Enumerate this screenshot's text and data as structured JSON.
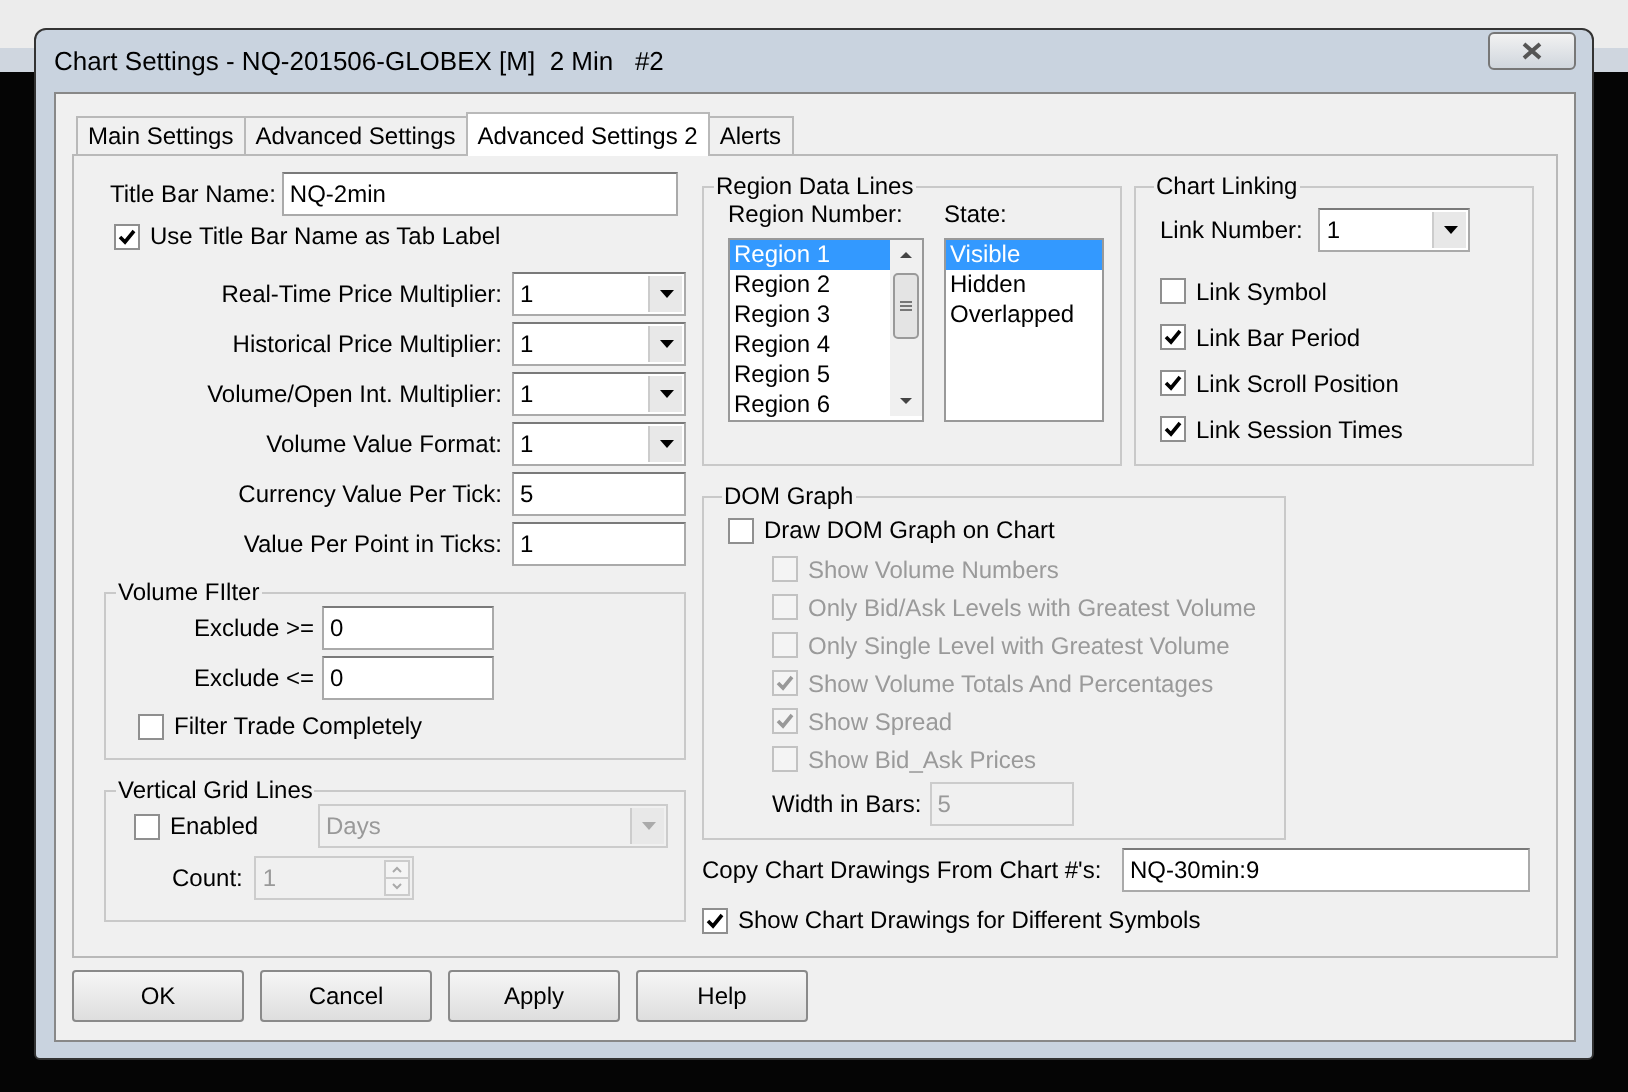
{
  "window": {
    "title": "Chart Settings - NQ-201506-GLOBEX [M]  2 Min   #2"
  },
  "tabs": [
    {
      "label": "Main Settings",
      "selected": false
    },
    {
      "label": "Advanced Settings",
      "selected": false
    },
    {
      "label": "Advanced Settings 2",
      "selected": true
    },
    {
      "label": "Alerts",
      "selected": false
    }
  ],
  "title_bar_name": {
    "label": "Title Bar Name:",
    "value": "NQ-2min"
  },
  "use_title_as_tab": {
    "label": "Use Title Bar Name as Tab Label",
    "checked": true
  },
  "settings": [
    {
      "label": "Real-Time Price Multiplier:",
      "kind": "dropdown",
      "value": "1"
    },
    {
      "label": "Historical Price Multiplier:",
      "kind": "dropdown",
      "value": "1"
    },
    {
      "label": "Volume/Open Int. Multiplier:",
      "kind": "dropdown",
      "value": "1"
    },
    {
      "label": "Volume Value Format:",
      "kind": "dropdown",
      "value": "1"
    },
    {
      "label": "Currency Value Per Tick:",
      "kind": "text",
      "value": "5"
    },
    {
      "label": "Value Per Point in Ticks:",
      "kind": "text",
      "value": "1"
    }
  ],
  "volume_filter": {
    "title": "Volume FIlter",
    "fields": [
      {
        "label": "Exclude >=",
        "value": "0"
      },
      {
        "label": "Exclude <=",
        "value": "0"
      }
    ],
    "filter_completely": {
      "label": "Filter Trade Completely",
      "checked": false
    }
  },
  "vertical_grid_lines": {
    "title": "Vertical Grid Lines",
    "enabled": {
      "label": "Enabled",
      "checked": false
    },
    "unit": {
      "value": "Days",
      "disabled": true
    },
    "count": {
      "label": "Count:",
      "value": "1",
      "disabled": true
    }
  },
  "region_data_lines": {
    "title": "Region Data Lines",
    "region_number": {
      "label": "Region Number:",
      "items": [
        {
          "label": "Region 1",
          "selected": true
        },
        {
          "label": "Region 2",
          "selected": false
        },
        {
          "label": "Region 3",
          "selected": false
        },
        {
          "label": "Region 4",
          "selected": false
        },
        {
          "label": "Region 5",
          "selected": false
        },
        {
          "label": "Region 6",
          "selected": false
        }
      ]
    },
    "state": {
      "label": "State:",
      "items": [
        {
          "label": "Visible",
          "selected": true
        },
        {
          "label": "Hidden",
          "selected": false
        },
        {
          "label": "Overlapped",
          "selected": false
        }
      ]
    }
  },
  "chart_linking": {
    "title": "Chart Linking",
    "link_number": {
      "label": "Link Number:",
      "value": "1"
    },
    "options": [
      {
        "label": "Link Symbol",
        "checked": false
      },
      {
        "label": "Link Bar Period",
        "checked": true
      },
      {
        "label": "Link Scroll Position",
        "checked": true
      },
      {
        "label": "Link Session Times",
        "checked": true
      }
    ]
  },
  "dom_graph": {
    "title": "DOM Graph",
    "draw": {
      "label": "Draw DOM Graph on Chart",
      "checked": false
    },
    "options": [
      {
        "label": "Show Volume Numbers",
        "checked": false,
        "disabled": true
      },
      {
        "label": "Only Bid/Ask Levels with Greatest Volume",
        "checked": false,
        "disabled": true
      },
      {
        "label": "Only Single Level with Greatest Volume",
        "checked": false,
        "disabled": true
      },
      {
        "label": "Show Volume Totals And Percentages",
        "checked": true,
        "disabled": true
      },
      {
        "label": "Show Spread",
        "checked": true,
        "disabled": true
      },
      {
        "label": "Show Bid_Ask Prices",
        "checked": false,
        "disabled": true
      }
    ],
    "width": {
      "label": "Width in Bars:",
      "value": "5",
      "disabled": true
    }
  },
  "copy_drawings": {
    "label": "Copy Chart Drawings From Chart #'s:",
    "value": "NQ-30min:9"
  },
  "show_drawings": {
    "label": "Show Chart Drawings for Different Symbols",
    "checked": true
  },
  "buttons": [
    "OK",
    "Cancel",
    "Apply",
    "Help"
  ]
}
